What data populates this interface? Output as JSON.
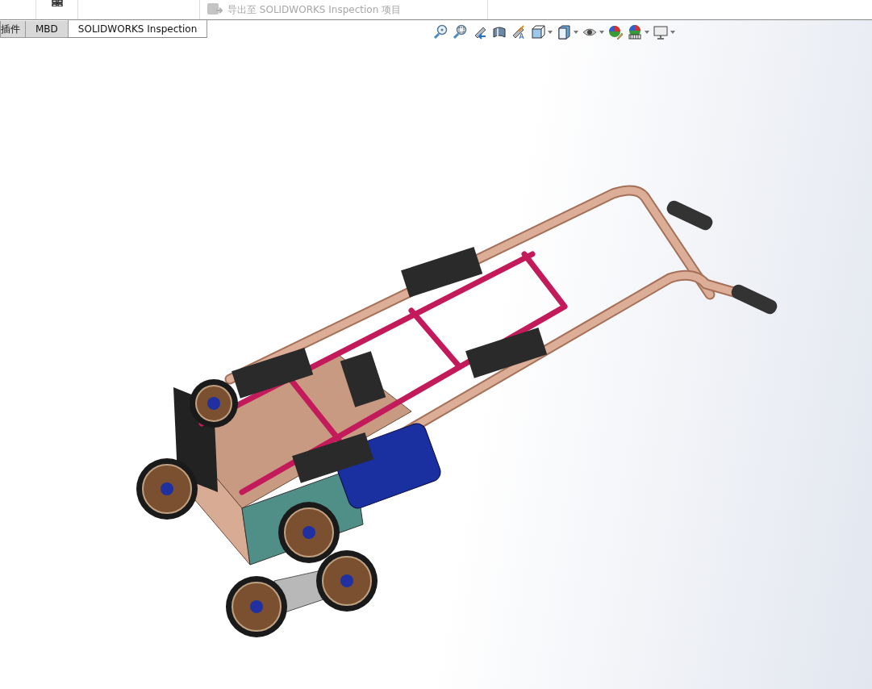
{
  "ribbon": {
    "export_button": {
      "label": "导出至 SOLIDWORKS Inspection 项目",
      "disabled": true
    }
  },
  "tabs": [
    {
      "label": "插件",
      "selected": false
    },
    {
      "label": "MBD",
      "selected": false
    },
    {
      "label": "SOLIDWORKS Inspection",
      "selected": true
    }
  ],
  "view_toolbar": [
    {
      "kind": "zoom-fit",
      "dropdown": false
    },
    {
      "kind": "zoom-area",
      "dropdown": false
    },
    {
      "kind": "previous-view",
      "dropdown": false
    },
    {
      "kind": "section",
      "dropdown": false
    },
    {
      "kind": "annotation",
      "dropdown": false
    },
    {
      "kind": "orientation",
      "dropdown": true
    },
    {
      "kind": "display-style",
      "dropdown": true
    },
    {
      "kind": "hide-show",
      "dropdown": true
    },
    {
      "kind": "appearance",
      "dropdown": false
    },
    {
      "kind": "scene",
      "dropdown": true
    },
    {
      "kind": "view-settings",
      "dropdown": true
    }
  ]
}
